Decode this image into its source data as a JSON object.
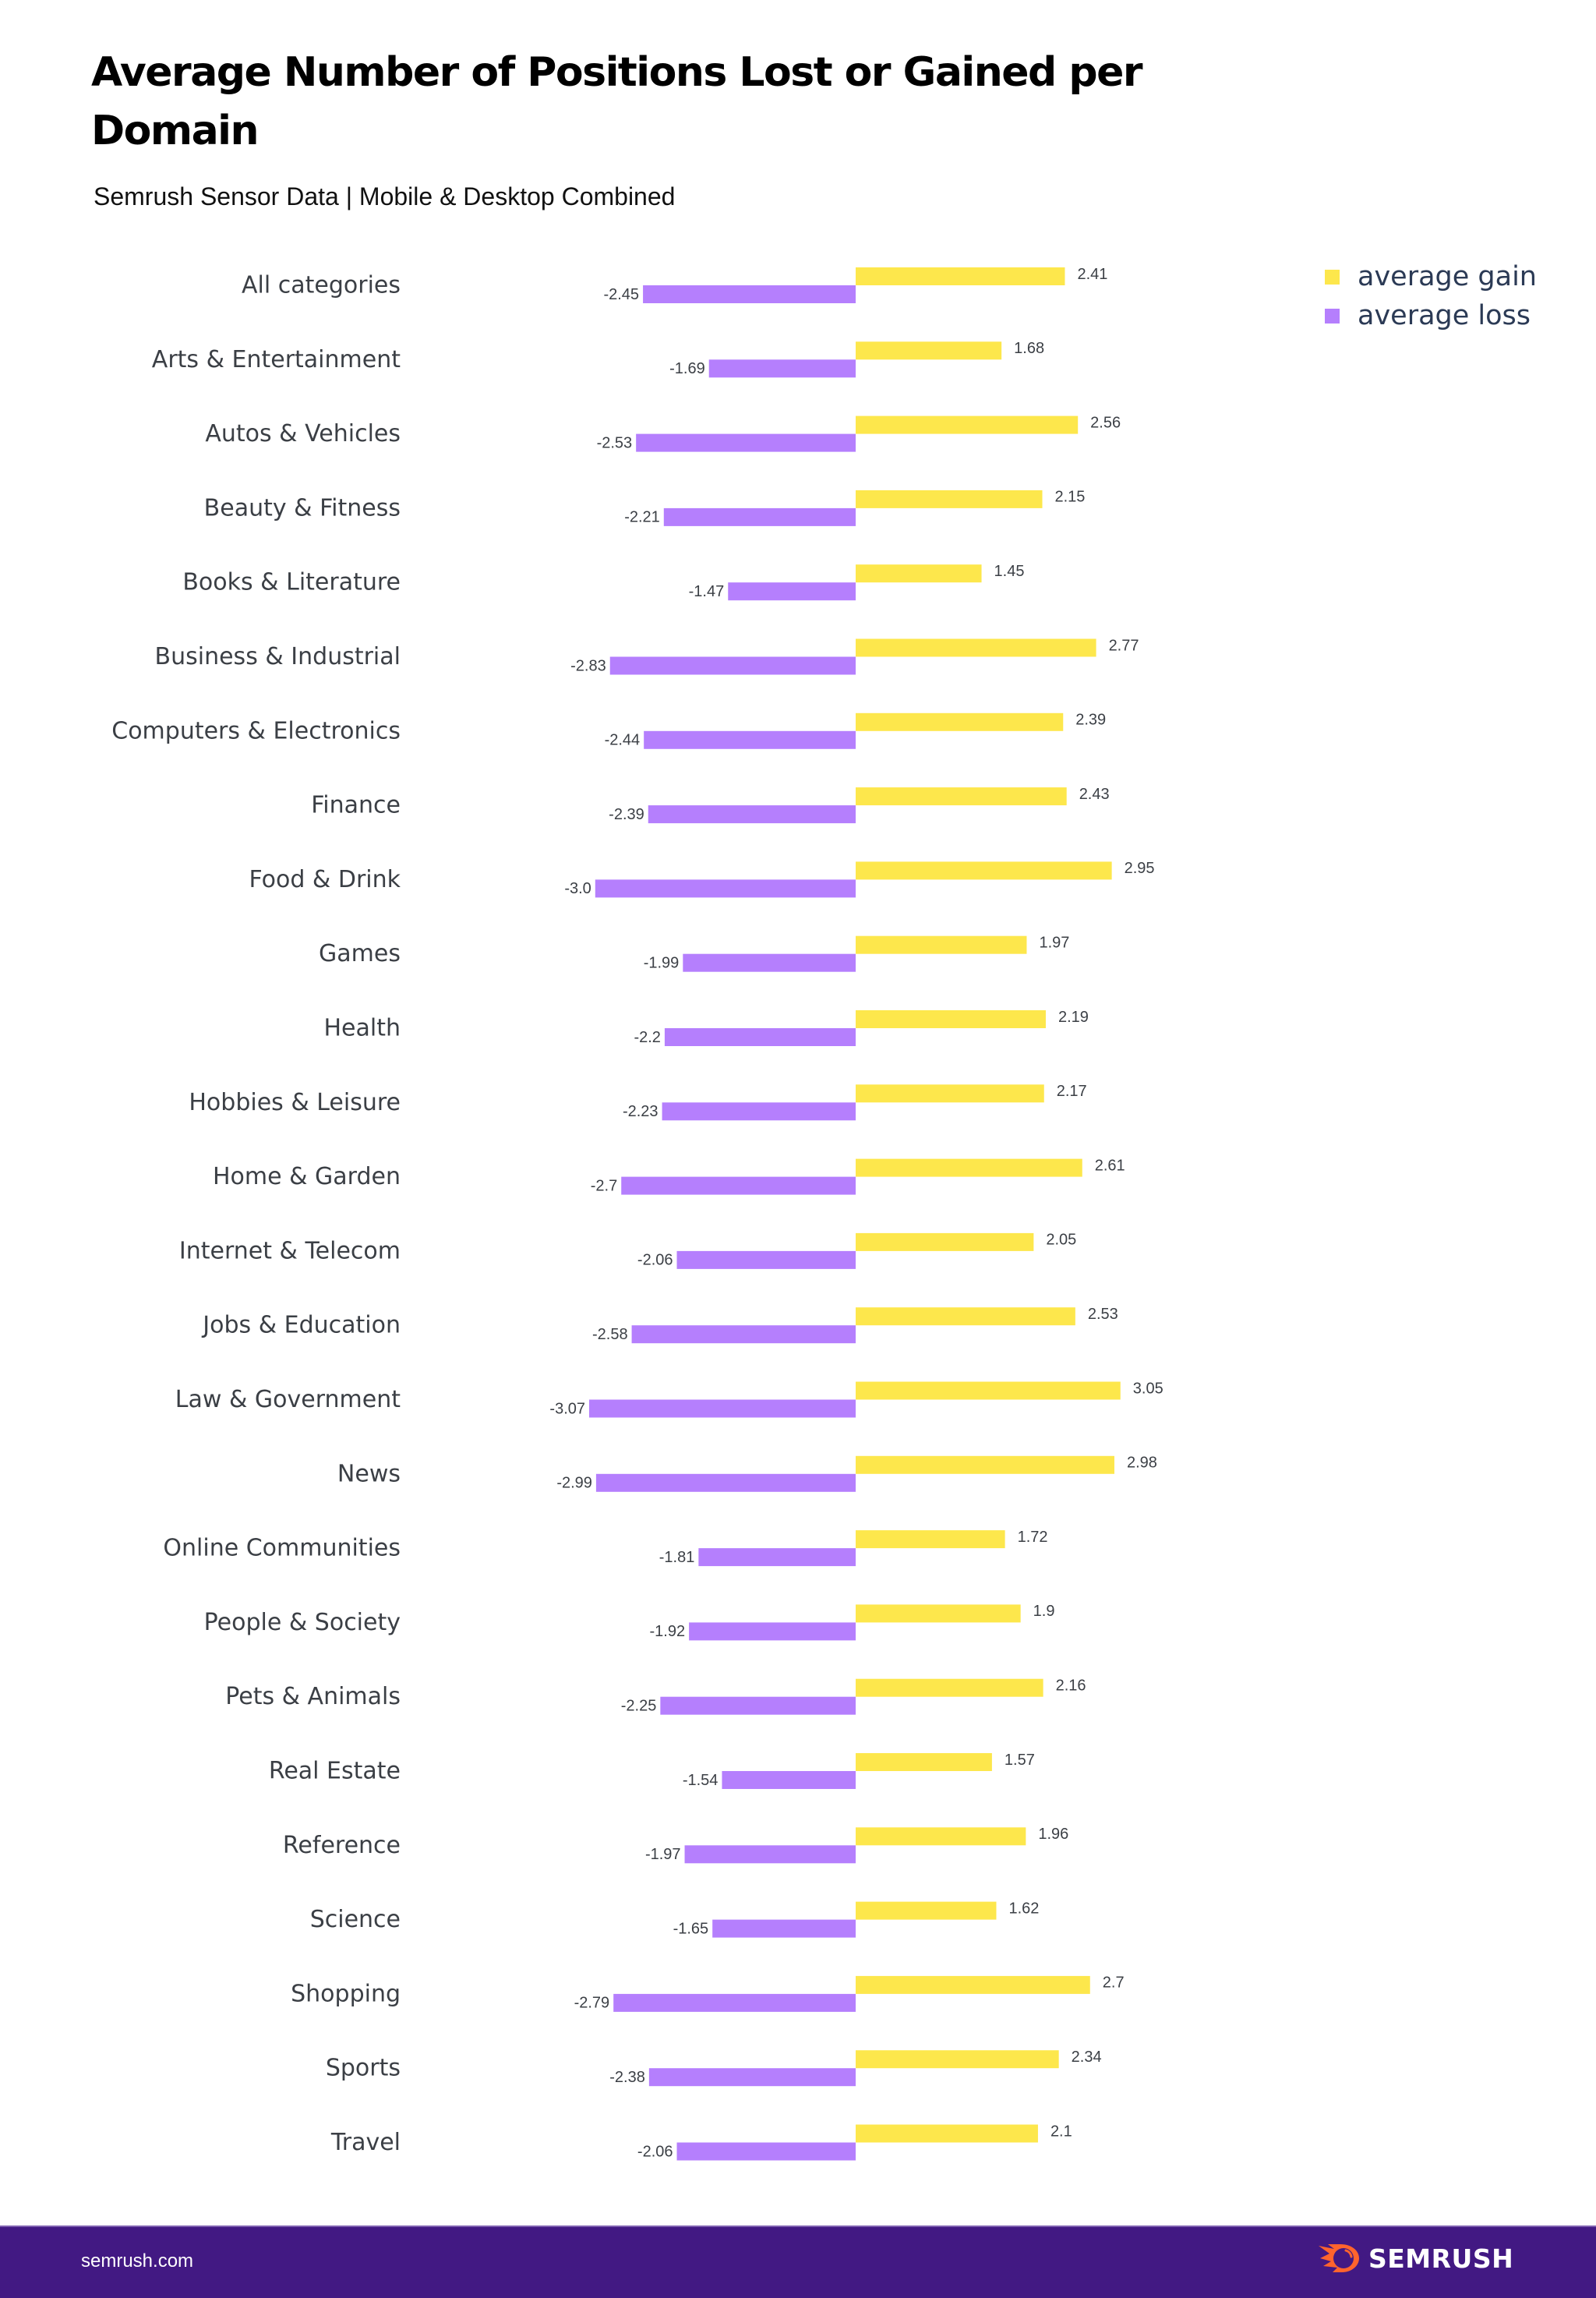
{
  "header": {
    "title": "Average Number of Positions Lost or Gained per Domain",
    "subtitle": "Semrush Sensor Data | Mobile & Desktop Combined"
  },
  "legend": {
    "items": [
      {
        "label": "average gain",
        "color": "#fde74c"
      },
      {
        "label": "average loss",
        "color": "#b57ffd"
      }
    ]
  },
  "footer": {
    "url": "semrush.com",
    "brand": "SEMRUSH",
    "brand_icon": "semrush-fireball-icon",
    "background": "#421983",
    "icon_color": "#ff642d"
  },
  "chart_data": {
    "type": "bar",
    "orientation": "horizontal",
    "title": "Average Number of Positions Lost or Gained per Domain",
    "subtitle": "Semrush Sensor Data | Mobile & Desktop Combined",
    "xlabel": "",
    "ylabel": "",
    "grid": false,
    "legend_position": "top-right",
    "categories": [
      "All categories",
      "Arts & Entertainment",
      "Autos & Vehicles",
      "Beauty & Fitness",
      "Books & Literature",
      "Business & Industrial",
      "Computers & Electronics",
      "Finance",
      "Food & Drink",
      "Games",
      "Health",
      "Hobbies & Leisure",
      "Home & Garden",
      "Internet & Telecom",
      "Jobs & Education",
      "Law & Government",
      "News",
      "Online Communities",
      "People & Society",
      "Pets & Animals",
      "Real Estate",
      "Reference",
      "Science",
      "Shopping",
      "Sports",
      "Travel"
    ],
    "series": [
      {
        "name": "average gain",
        "color": "#fde74c",
        "values": [
          2.41,
          1.68,
          2.56,
          2.15,
          1.45,
          2.77,
          2.39,
          2.43,
          2.95,
          1.97,
          2.19,
          2.17,
          2.61,
          2.05,
          2.53,
          3.05,
          2.98,
          1.72,
          1.9,
          2.16,
          1.57,
          1.96,
          1.62,
          2.7,
          2.34,
          2.1
        ],
        "labels": [
          "2.41",
          "1.68",
          "2.56",
          "2.15",
          "1.45",
          "2.77",
          "2.39",
          "2.43",
          "2.95",
          "1.97",
          "2.19",
          "2.17",
          "2.61",
          "2.05",
          "2.53",
          "3.05",
          "2.98",
          "1.72",
          "1.9",
          "2.16",
          "1.57",
          "1.96",
          "1.62",
          "2.7",
          "2.34",
          "2.1"
        ]
      },
      {
        "name": "average loss",
        "color": "#b57ffd",
        "values": [
          -2.45,
          -1.69,
          -2.53,
          -2.21,
          -1.47,
          -2.83,
          -2.44,
          -2.39,
          -3.0,
          -1.99,
          -2.2,
          -2.23,
          -2.7,
          -2.06,
          -2.58,
          -3.07,
          -2.99,
          -1.81,
          -1.92,
          -2.25,
          -1.54,
          -1.97,
          -1.65,
          -2.79,
          -2.38,
          -2.06
        ],
        "labels": [
          "-2.45",
          "-1.69",
          "-2.53",
          "-2.21",
          "-1.47",
          "-2.83",
          "-2.44",
          "-2.39",
          "-3.0",
          "-1.99",
          "-2.2",
          "-2.23",
          "-2.7",
          "-2.06",
          "-2.58",
          "-3.07",
          "-2.99",
          "-1.81",
          "-1.92",
          "-2.25",
          "-1.54",
          "-1.97",
          "-1.65",
          "-2.79",
          "-2.38",
          "-2.06"
        ]
      }
    ],
    "xlim": [
      -3.2,
      3.2
    ]
  }
}
